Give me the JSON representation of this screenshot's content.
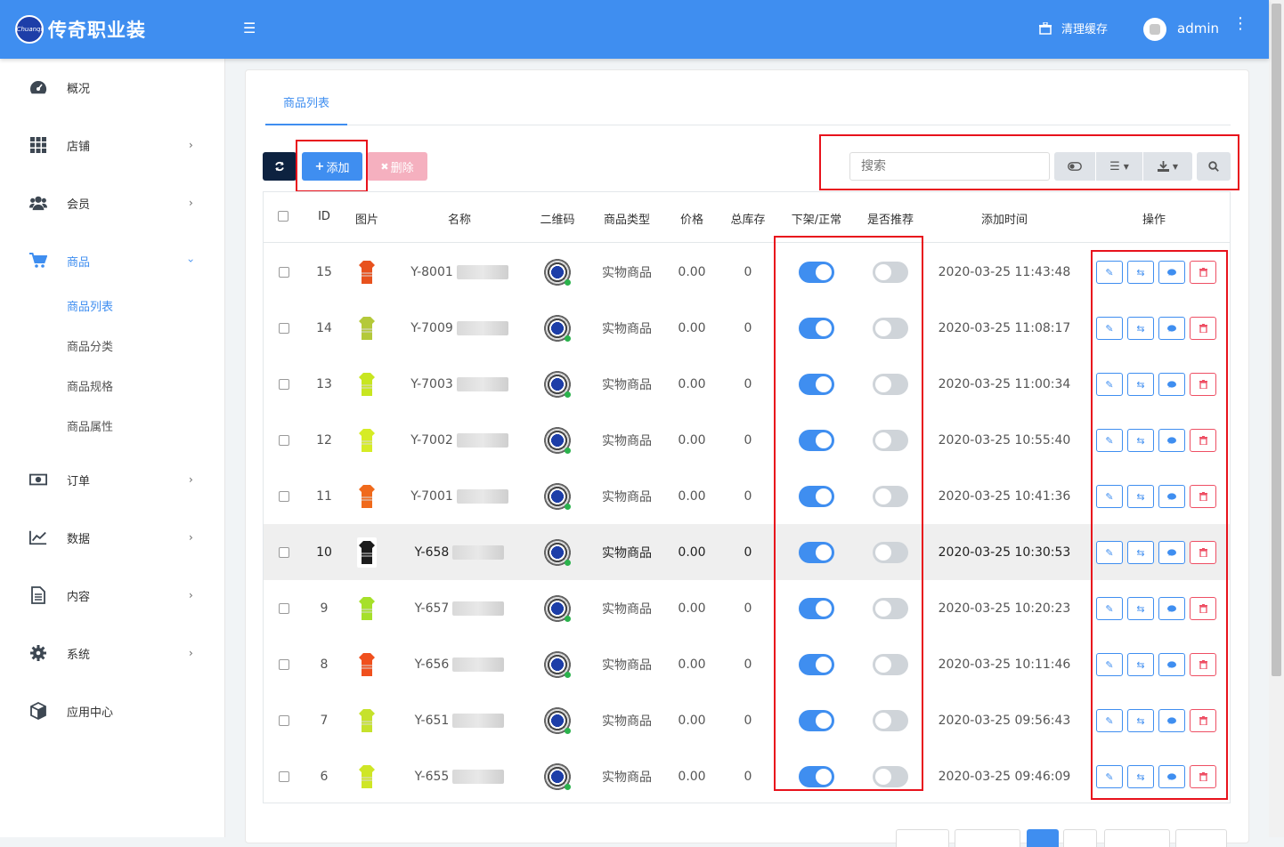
{
  "header": {
    "brand_name": "传奇职业装",
    "brand_logo_text": "Chuanqi",
    "clear_cache_label": "清理缓存",
    "username": "admin"
  },
  "sidebar": {
    "items": [
      {
        "label": "概况",
        "icon": "dashboard-icon"
      },
      {
        "label": "店铺",
        "icon": "grid-icon"
      },
      {
        "label": "会员",
        "icon": "users-icon"
      },
      {
        "label": "商品",
        "icon": "cart-icon"
      },
      {
        "label": "订单",
        "icon": "money-icon"
      },
      {
        "label": "数据",
        "icon": "line-chart-icon"
      },
      {
        "label": "内容",
        "icon": "document-icon"
      },
      {
        "label": "系统",
        "icon": "gear-icon"
      },
      {
        "label": "应用中心",
        "icon": "cube-icon"
      }
    ],
    "subitems": [
      "商品列表",
      "商品分类",
      "商品规格",
      "商品属性"
    ]
  },
  "tabs": [
    "商品列表"
  ],
  "toolbar": {
    "add_label": "添加",
    "delete_label": "删除",
    "search_placeholder": "搜索"
  },
  "table": {
    "headers": [
      "ID",
      "图片",
      "名称",
      "二维码",
      "商品类型",
      "价格",
      "总库存",
      "下架/正常",
      "是否推荐",
      "添加时间",
      "操作"
    ],
    "rows": [
      {
        "id": "15",
        "name": "Y-8001",
        "type": "实物商品",
        "price": "0.00",
        "stock": "0",
        "on_sale": true,
        "recommended": false,
        "time": "2020-03-25 11:43:48",
        "img_color": "#e8521e"
      },
      {
        "id": "14",
        "name": "Y-7009",
        "type": "实物商品",
        "price": "0.00",
        "stock": "0",
        "on_sale": true,
        "recommended": false,
        "time": "2020-03-25 11:08:17",
        "img_color": "#b4c93a"
      },
      {
        "id": "13",
        "name": "Y-7003",
        "type": "实物商品",
        "price": "0.00",
        "stock": "0",
        "on_sale": true,
        "recommended": false,
        "time": "2020-03-25 11:00:34",
        "img_color": "#c8e620"
      },
      {
        "id": "12",
        "name": "Y-7002",
        "type": "实物商品",
        "price": "0.00",
        "stock": "0",
        "on_sale": true,
        "recommended": false,
        "time": "2020-03-25 10:55:40",
        "img_color": "#d6ec26"
      },
      {
        "id": "11",
        "name": "Y-7001",
        "type": "实物商品",
        "price": "0.00",
        "stock": "0",
        "on_sale": true,
        "recommended": false,
        "time": "2020-03-25 10:41:36",
        "img_color": "#f06a1c"
      },
      {
        "id": "10",
        "name": "Y-658",
        "type": "实物商品",
        "price": "0.00",
        "stock": "0",
        "on_sale": true,
        "recommended": false,
        "time": "2020-03-25 10:30:53",
        "img_color": "#1c1c1c"
      },
      {
        "id": "9",
        "name": "Y-657",
        "type": "实物商品",
        "price": "0.00",
        "stock": "0",
        "on_sale": true,
        "recommended": false,
        "time": "2020-03-25 10:20:23",
        "img_color": "#a6e02a"
      },
      {
        "id": "8",
        "name": "Y-656",
        "type": "实物商品",
        "price": "0.00",
        "stock": "0",
        "on_sale": true,
        "recommended": false,
        "time": "2020-03-25 10:11:46",
        "img_color": "#f0501e"
      },
      {
        "id": "7",
        "name": "Y-651",
        "type": "实物商品",
        "price": "0.00",
        "stock": "0",
        "on_sale": true,
        "recommended": false,
        "time": "2020-03-25 09:56:43",
        "img_color": "#c6e22c"
      },
      {
        "id": "6",
        "name": "Y-655",
        "type": "实物商品",
        "price": "0.00",
        "stock": "0",
        "on_sale": true,
        "recommended": false,
        "time": "2020-03-25 09:46:09",
        "img_color": "#cfe626"
      }
    ]
  },
  "colors": {
    "primary": "#3f8ef0",
    "danger": "#ee4f64",
    "annotation": "#e8121c"
  }
}
